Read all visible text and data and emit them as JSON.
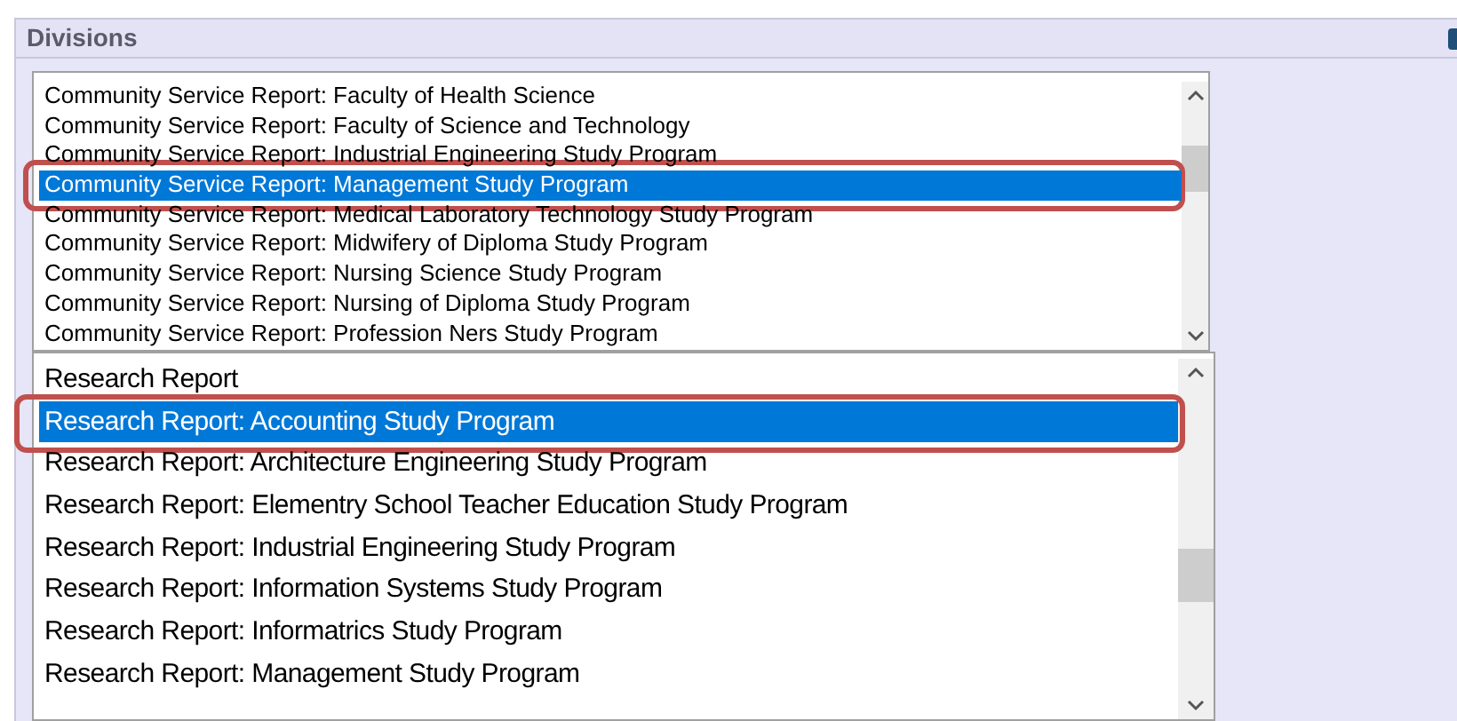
{
  "panel": {
    "title": "Divisions"
  },
  "lists": [
    {
      "kind": "small",
      "rows": [
        {
          "label": "Community Service Report: Faculty of Health Science",
          "selected": false
        },
        {
          "label": "Community Service Report: Faculty of Science and Technology",
          "selected": false
        },
        {
          "label": "Community Service Report: Industrial Engineering Study Program",
          "selected": false
        },
        {
          "label": "Community Service Report: Management Study Program",
          "selected": true
        },
        {
          "label": "Community Service Report: Medical Laboratory Technology Study Program",
          "selected": false
        },
        {
          "label": "Community Service Report: Midwifery of Diploma Study Program",
          "selected": false
        },
        {
          "label": "Community Service Report: Nursing Science Study Program",
          "selected": false
        },
        {
          "label": "Community Service Report: Nursing of Diploma Study Program",
          "selected": false
        },
        {
          "label": "Community Service Report: Profession Ners Study Program",
          "selected": false
        }
      ]
    },
    {
      "kind": "large",
      "rows": [
        {
          "label": "Research Report",
          "selected": false
        },
        {
          "label": "Research Report: Accounting Study Program",
          "selected": true
        },
        {
          "label": "Research Report: Architecture Engineering Study Program",
          "selected": false
        },
        {
          "label": "Research Report: Elementry School Teacher Education Study Program",
          "selected": false
        },
        {
          "label": "Research Report: Industrial Engineering Study Program",
          "selected": false
        },
        {
          "label": "Research Report: Information Systems Study Program",
          "selected": false
        },
        {
          "label": "Research Report: Informatrics Study Program",
          "selected": false
        },
        {
          "label": "Research Report: Management Study Program",
          "selected": false
        }
      ]
    }
  ]
}
